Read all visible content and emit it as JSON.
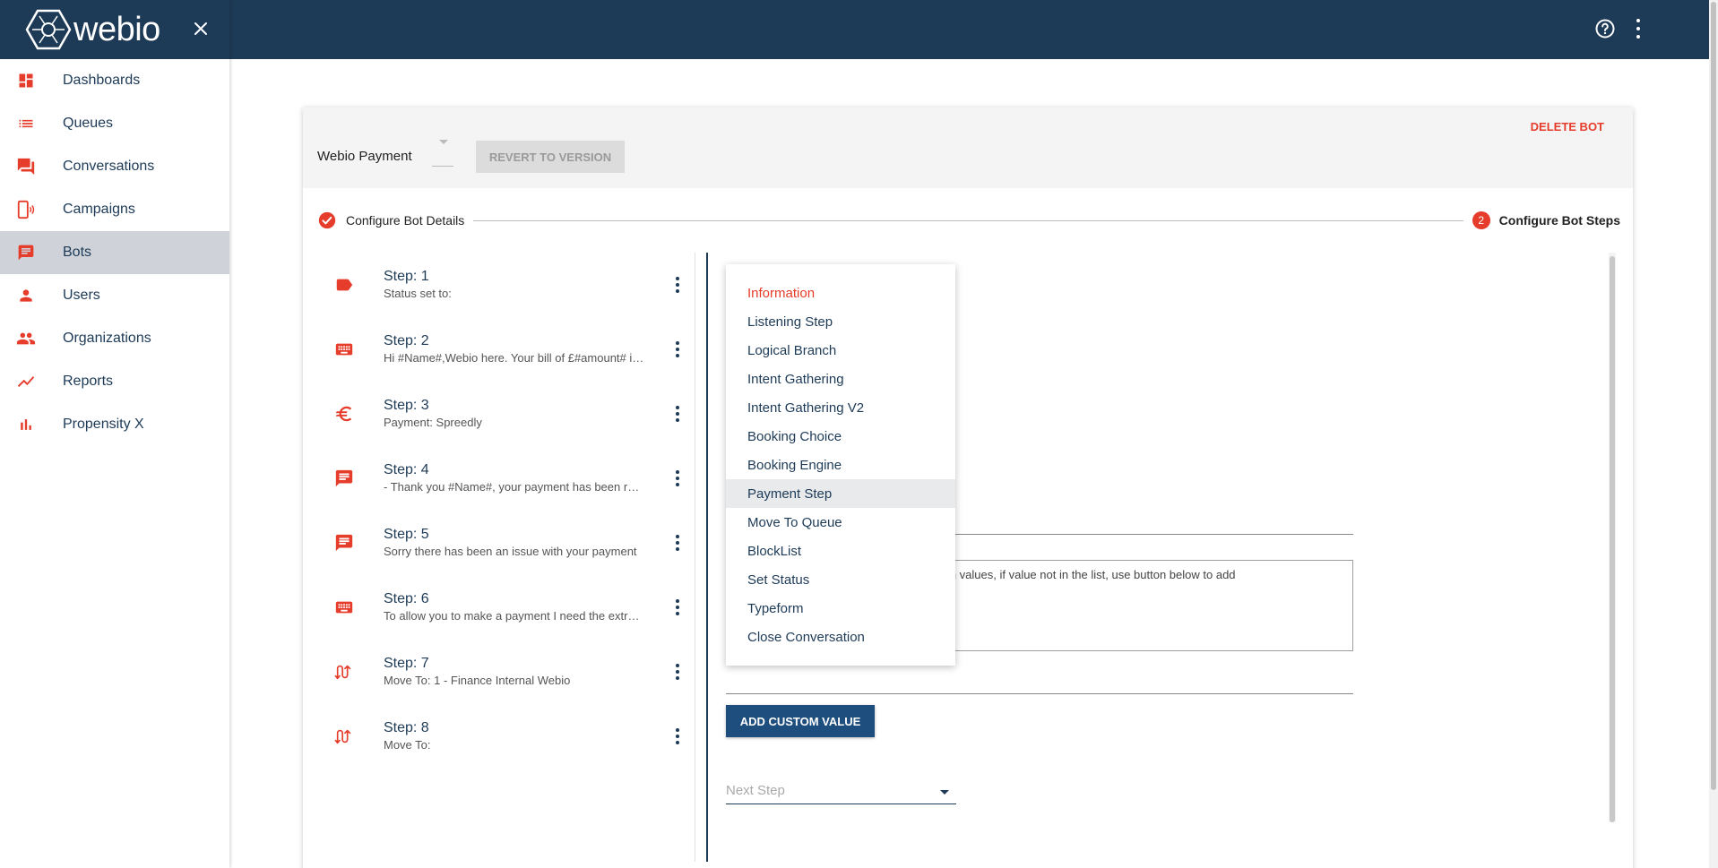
{
  "app": {
    "logo_text": "webio",
    "colors": {
      "navy": "#1d3a57",
      "accent": "#e53c2b",
      "button_blue": "#1d4e7d"
    }
  },
  "sidebar": {
    "items": [
      {
        "label": "Dashboards",
        "icon": "dashboard-icon",
        "active": false
      },
      {
        "label": "Queues",
        "icon": "list-icon",
        "active": false
      },
      {
        "label": "Conversations",
        "icon": "forum-icon",
        "active": false
      },
      {
        "label": "Campaigns",
        "icon": "campaign-phone-icon",
        "active": false
      },
      {
        "label": "Bots",
        "icon": "chat-icon",
        "active": true
      },
      {
        "label": "Users",
        "icon": "person-icon",
        "active": false
      },
      {
        "label": "Organizations",
        "icon": "people-icon",
        "active": false
      },
      {
        "label": "Reports",
        "icon": "trend-icon",
        "active": false
      },
      {
        "label": "Propensity X",
        "icon": "bar-chart-icon",
        "active": false
      }
    ]
  },
  "header": {
    "bot_name": "Webio Payment",
    "revert_label": "REVERT TO VERSION",
    "delete_label": "DELETE BOT"
  },
  "stepper": {
    "step1_label": "Configure Bot Details",
    "step2_number": "2",
    "step2_label": "Configure Bot Steps"
  },
  "steps": [
    {
      "title": "Step: 1",
      "subtitle": "Status set to:",
      "icon": "label-icon"
    },
    {
      "title": "Step: 2",
      "subtitle": "Hi #Name#,Webio here. Your bill of £#amount# is due",
      "icon": "keyboard-icon"
    },
    {
      "title": "Step: 3",
      "subtitle": "Payment: Spreedly",
      "icon": "euro-icon"
    },
    {
      "title": "Step: 4",
      "subtitle": "- Thank you #Name#, your payment has been received",
      "icon": "message-icon"
    },
    {
      "title": "Step: 5",
      "subtitle": "Sorry there has been an issue with your payment",
      "icon": "message-icon"
    },
    {
      "title": "Step: 6",
      "subtitle": "To allow you to make a payment I need the extra details",
      "icon": "keyboard-icon"
    },
    {
      "title": "Step: 7",
      "subtitle": "Move To: 1 - Finance Internal Webio",
      "icon": "route-icon"
    },
    {
      "title": "Step: 8",
      "subtitle": "Move To:",
      "icon": "route-icon"
    }
  ],
  "dropdown": {
    "header": "Information",
    "items": [
      "Listening Step",
      "Logical Branch",
      "Intent Gathering",
      "Intent Gathering V2",
      "Booking Choice",
      "Booking Engine",
      "Payment Step",
      "Move To Queue",
      "BlockList",
      "Set Status",
      "Typeform",
      "Close Conversation"
    ],
    "highlighted": "Payment Step"
  },
  "editor": {
    "custom_values_hint": "om values, if value not in the list, use button below to add",
    "add_custom_label": "ADD CUSTOM VALUE",
    "next_step_placeholder": "Next Step"
  }
}
